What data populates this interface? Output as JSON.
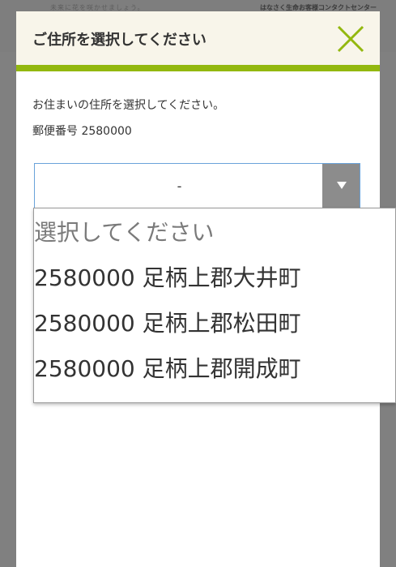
{
  "background": {
    "left_text": "未来に花を咲かせましょう。",
    "right_text": "はなさく生命お客様コンタクトセンター"
  },
  "modal": {
    "title": "ご住所を選択してください",
    "instruction": "お住まいの住所を選択してください。",
    "postal_label": "郵便番号 2580000",
    "select_value": "-"
  },
  "dropdown": {
    "options": [
      "選択してください",
      "2580000 足柄上郡大井町",
      "2580000 足柄上郡松田町",
      "2580000 足柄上郡開成町"
    ]
  },
  "colors": {
    "accent_green": "#93b80f",
    "header_bg": "#f8f5ea",
    "select_border": "#6aa3da",
    "arrow_bg": "#8c8c8c"
  },
  "icons": {
    "close": "close-icon",
    "dropdown_arrow": "chevron-down-icon"
  }
}
